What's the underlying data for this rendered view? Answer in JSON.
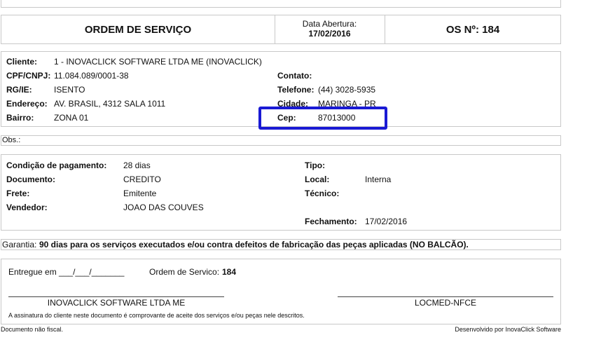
{
  "header": {
    "title": "ORDEM DE SERVIÇO",
    "data_abertura_label": "Data Abertura:",
    "data_abertura_value": "17/02/2016",
    "os_label": "OS Nº:",
    "os_value": "184"
  },
  "cliente": {
    "cliente_label": "Cliente:",
    "cliente_value": "1 - INOVACLICK SOFTWARE LTDA ME (INOVACLICK)",
    "cpf_label": "CPF/CNPJ:",
    "cpf_value": "11.084.089/0001-38",
    "rg_label": "RG/IE:",
    "rg_value": "ISENTO",
    "endereco_label": "Endereço:",
    "endereco_value": "AV. BRASIL, 4312 SALA 1011",
    "bairro_label": "Bairro:",
    "bairro_value": "ZONA 01",
    "contato_label": "Contato:",
    "contato_value": "",
    "telefone_label": "Telefone:",
    "telefone_value": "(44) 3028-5935",
    "cidade_label": "Cidade:",
    "cidade_value": "MARINGA - PR",
    "cep_label": "Cep:",
    "cep_value": "87013000"
  },
  "obs": {
    "label": "Obs.:"
  },
  "pagamento": {
    "condicao_label": "Condição de pagamento:",
    "condicao_value": "28 dias",
    "documento_label": "Documento:",
    "documento_value": "CREDITO",
    "frete_label": "Frete:",
    "frete_value": "Emitente",
    "vendedor_label": "Vendedor:",
    "vendedor_value": "JOAO DAS COUVES",
    "tipo_label": "Tipo:",
    "tipo_value": "",
    "local_label": "Local:",
    "local_value": "Interna",
    "tecnico_label": "Técnico:",
    "tecnico_value": "",
    "fechamento_label": "Fechamento:",
    "fechamento_value": "17/02/2016"
  },
  "garantia": {
    "label": "Garantia:",
    "text": "90 dias para os serviços executados e/ou contra defeitos de fabricação das peças aplicadas (NO BALCÃO)."
  },
  "entrega": {
    "entregue_em": "Entregue em ___/___/_______",
    "ordem_label": "Ordem de Servico:",
    "ordem_value": "184",
    "signer_left": "INOVACLICK SOFTWARE LTDA ME",
    "signer_right": "LOCMED-NFCE",
    "disclaimer": "A assinatura do cliente neste documento é comprovante de aceite dos serviços e/ou peças nele descritos."
  },
  "footer": {
    "left": "Documento não fiscal.",
    "right": "Desenvolvido por InovaClick Software"
  },
  "highlight_color": "#1a1ad4"
}
